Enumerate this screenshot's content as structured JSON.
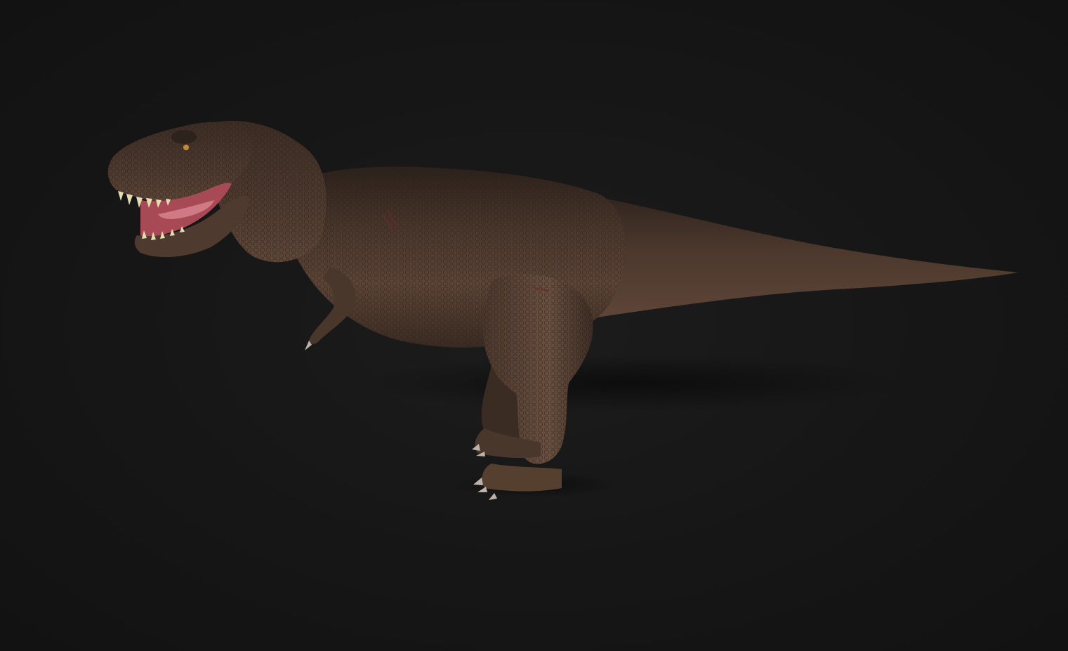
{
  "scene": {
    "subject": "dinosaur-model",
    "colors": {
      "background": "#151515",
      "skin_dark": "#2e221c",
      "skin_mid": "#4a372c",
      "skin_light": "#6b5243",
      "mouth": "#a84a55",
      "tongue": "#d07a85",
      "teeth": "#e4dcb0",
      "claws": "#bdb3aa",
      "shadow": "#0c0c0c"
    }
  }
}
